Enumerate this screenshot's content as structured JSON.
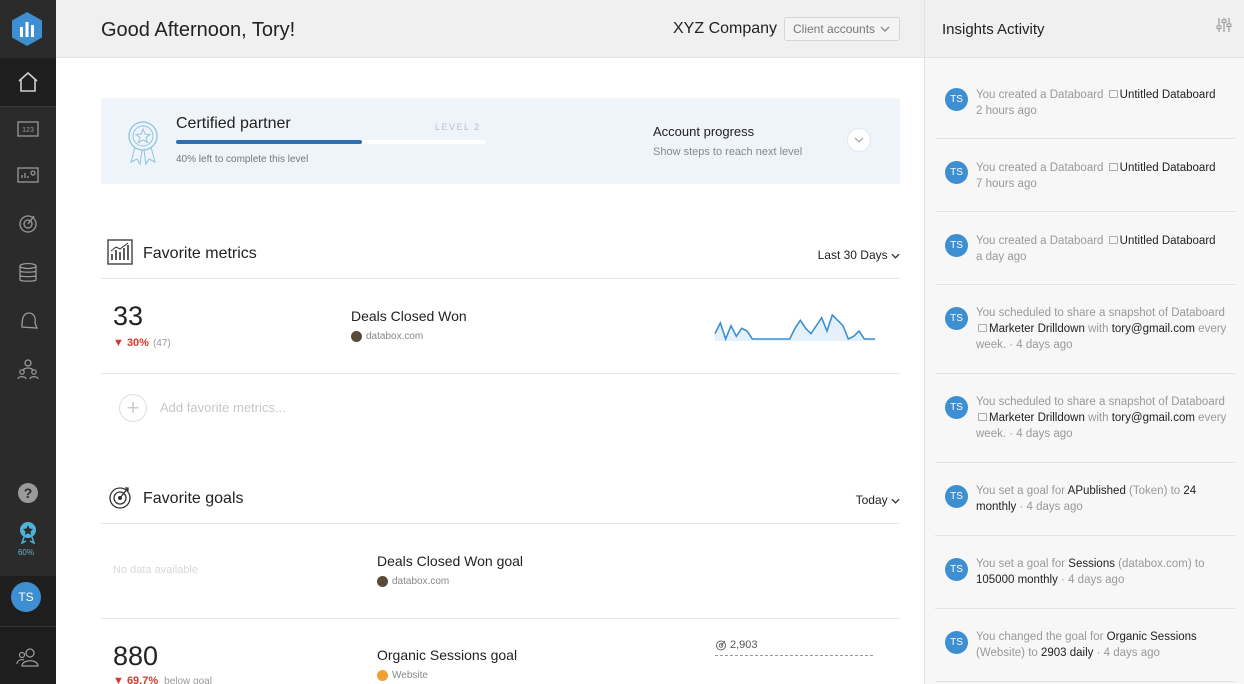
{
  "header": {
    "greeting": "Good Afternoon, Tory!",
    "company": "XYZ Company",
    "client_accounts": "Client accounts"
  },
  "sidebar": {
    "badge_percent": "60%",
    "avatar_initials": "TS"
  },
  "partner": {
    "title": "Certified partner",
    "level": "LEVEL 2",
    "progress_fraction": 0.6,
    "note": "40% left to complete this level",
    "account_title": "Account progress",
    "account_sub": "Show steps to reach next level"
  },
  "metrics": {
    "title": "Favorite metrics",
    "filter": "Last 30 Days",
    "item": {
      "value": "33",
      "delta": "▼ 30%",
      "previous": "(47)",
      "name": "Deals Closed Won",
      "source": "databox.com",
      "sparkline": [
        8,
        4,
        10,
        5,
        9,
        6,
        7,
        10,
        10,
        10,
        10,
        10,
        10,
        10,
        10,
        6,
        3,
        6,
        8,
        5,
        2,
        7,
        1,
        3,
        5,
        10,
        9,
        7,
        10,
        10,
        10
      ]
    },
    "add_label": "Add favorite metrics..."
  },
  "goals": {
    "title": "Favorite goals",
    "filter": "Today",
    "item1": {
      "empty": "No data available",
      "name": "Deals Closed Won goal",
      "source": "databox.com"
    },
    "item2": {
      "value": "880",
      "delta": "▼ 69.7%",
      "below": "below goal",
      "name": "Organic Sessions goal",
      "source": "Website",
      "target": "2,903"
    }
  },
  "insights": {
    "title": "Insights Activity",
    "items": [
      {
        "initials": "TS",
        "pre": "You created a Databoard",
        "link": "Untitled Databoard",
        "time": "2 hours ago"
      },
      {
        "initials": "TS",
        "pre": "You created a Databoard",
        "link": "Untitled Databoard",
        "time": "7 hours ago"
      },
      {
        "initials": "TS",
        "pre": "You created a Databoard",
        "link": "Untitled Databoard",
        "time": "a day ago"
      },
      {
        "initials": "TS",
        "pre": "You scheduled to share a snapshot of Databoard",
        "link": "Marketer Drilldown",
        "mid": "with",
        "email": "tory@gmail.com",
        "post": "every week.",
        "time": "4 days ago"
      },
      {
        "initials": "TS",
        "pre": "You scheduled to share a snapshot of Databoard",
        "link": "Marketer Drilldown",
        "mid": "with",
        "email": "tory@gmail.com",
        "post": "every week.",
        "time": "4 days ago"
      },
      {
        "initials": "TS",
        "pre": "You set a goal for",
        "metric": "APublished",
        "paren": "(Token) to",
        "value": "24 monthly",
        "time": "4 days ago"
      },
      {
        "initials": "TS",
        "pre": "You set a goal for",
        "metric": "Sessions",
        "paren": "(databox.com) to",
        "value": "105000 monthly",
        "time": "4 days ago"
      },
      {
        "initials": "TS",
        "pre": "You changed the goal for",
        "metric": "Organic Sessions",
        "paren": "(Website) to",
        "value": "2903 daily",
        "time": "4 days ago"
      }
    ]
  },
  "colors": {
    "accent": "#3d8fd1",
    "progress": "#2c6fb5",
    "negative": "#d33b2c",
    "sidebar": "#2b2b2b"
  }
}
